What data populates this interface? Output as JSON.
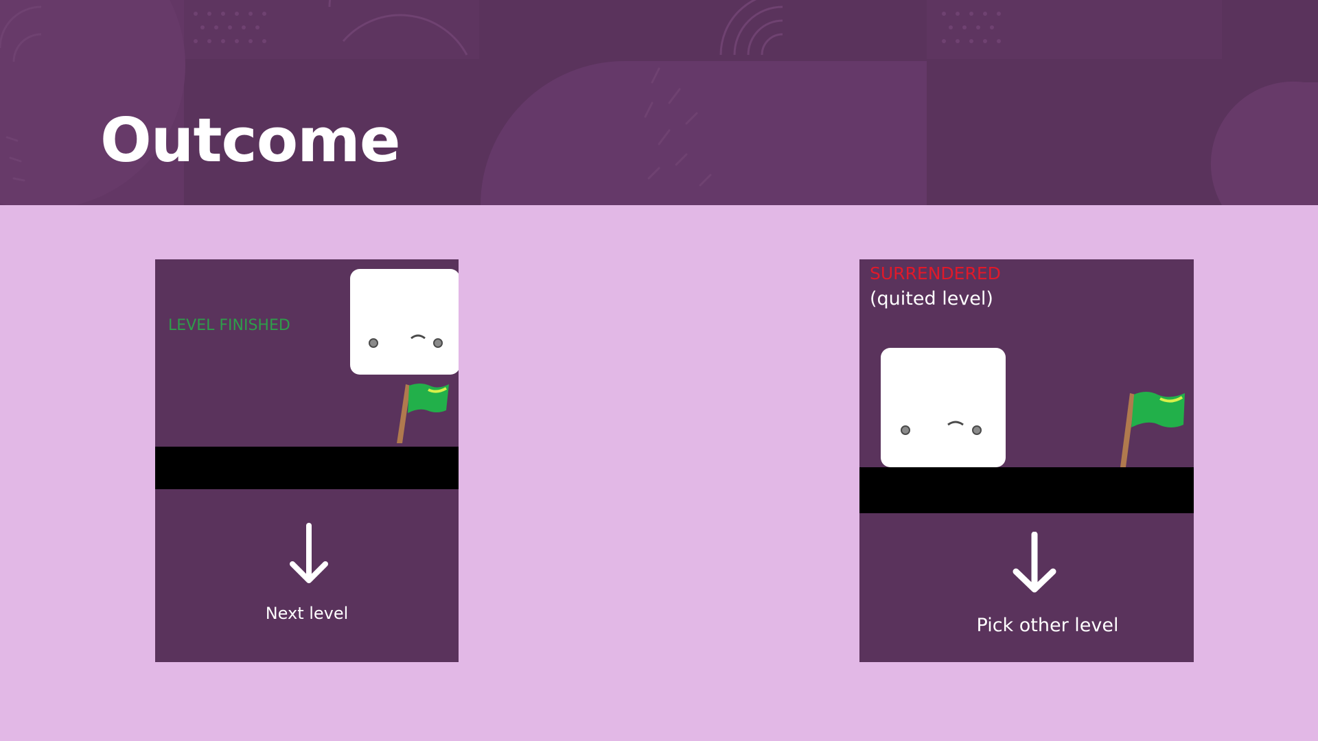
{
  "slide": {
    "title": "Outcome"
  },
  "panels": {
    "finished": {
      "status_text": "LEVEL FINISHED",
      "status_color": "#2e9e4a",
      "action_label": "Next level"
    },
    "surrendered": {
      "status_text": "SURRENDERED",
      "status_color": "#e0192a",
      "subtext": "(quited level)",
      "action_label": "Pick other level"
    }
  },
  "colors": {
    "header_bg": "#5a335c",
    "slide_bg": "#e2b8e6",
    "panel_bg": "#5a335c",
    "ground": "#000000",
    "flag_green": "#22b04a",
    "flag_pole": "#b07a4e"
  },
  "icons": [
    "cube-character-icon",
    "flag-icon",
    "down-arrow-icon"
  ]
}
